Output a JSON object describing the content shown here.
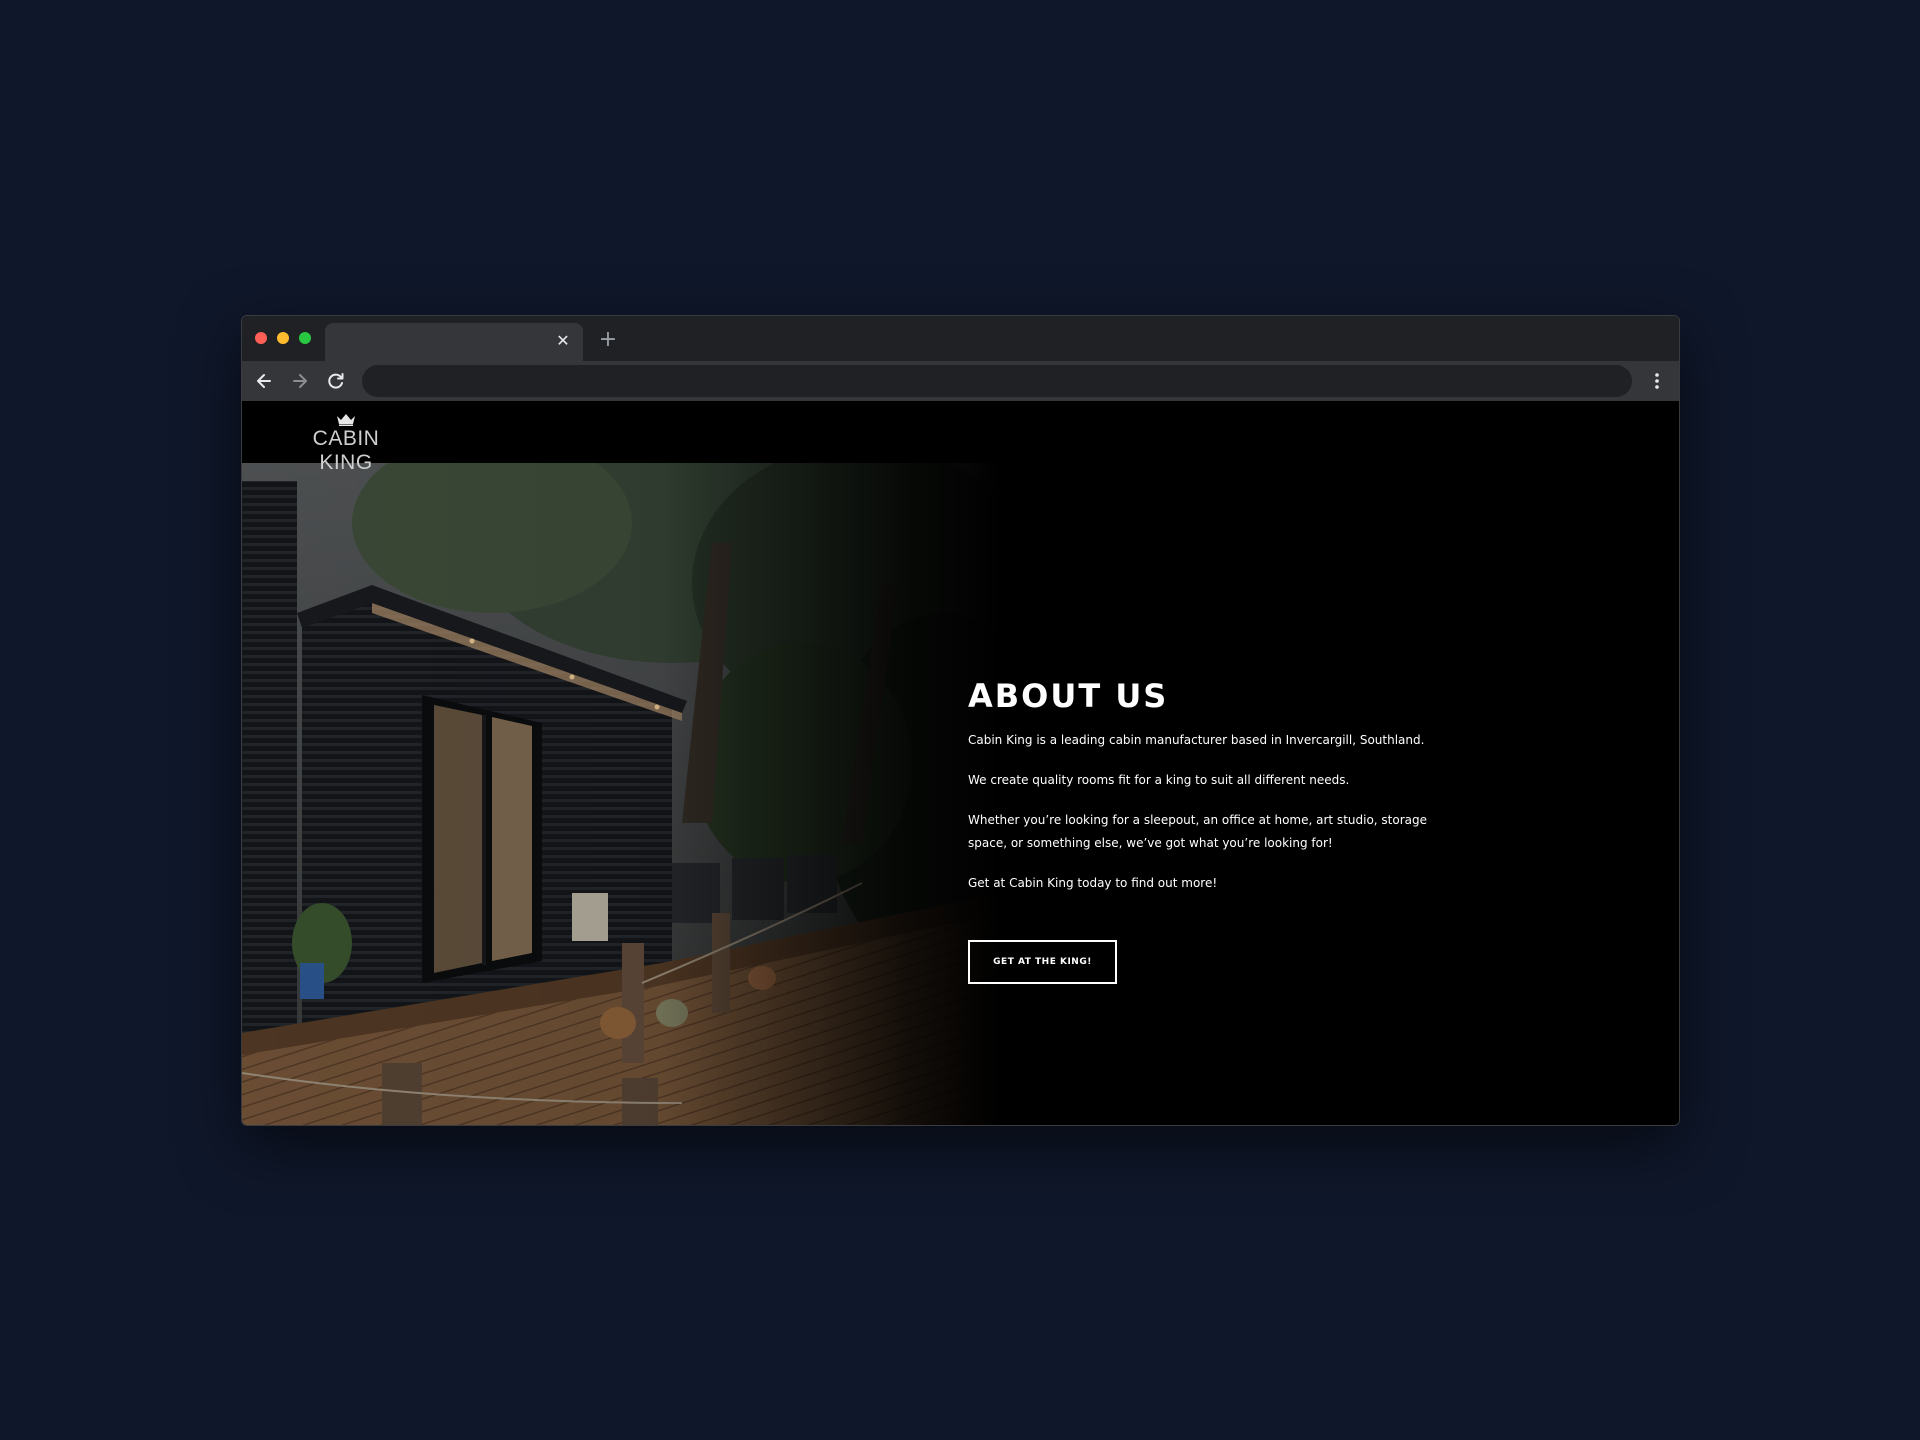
{
  "browser": {
    "tab_title": "",
    "address": "",
    "new_tab_glyph": "+",
    "close_glyph": "✕"
  },
  "site": {
    "logo_text": "CABIN KING"
  },
  "about": {
    "heading": "ABOUT US",
    "paragraphs": [
      "Cabin King is a leading cabin manufacturer based in Invercargill, Southland.",
      "We create quality rooms fit for a king to suit all different needs.",
      "Whether you’re looking for a sleepout, an office at home, art studio, storage space, or something else, we’ve got what you’re looking for!",
      "Get at Cabin King today to find out more!"
    ],
    "cta_label": "GET AT THE KING!"
  },
  "icons": {
    "back": "arrow-left-icon",
    "forward": "arrow-right-icon",
    "reload": "reload-icon",
    "menu": "kebab-menu-icon",
    "logo": "crown-icon"
  },
  "colors": {
    "backdrop": "#0f172a",
    "page_background": "#000000",
    "text": "#ffffff",
    "logo_text": "#cfcfcf"
  }
}
